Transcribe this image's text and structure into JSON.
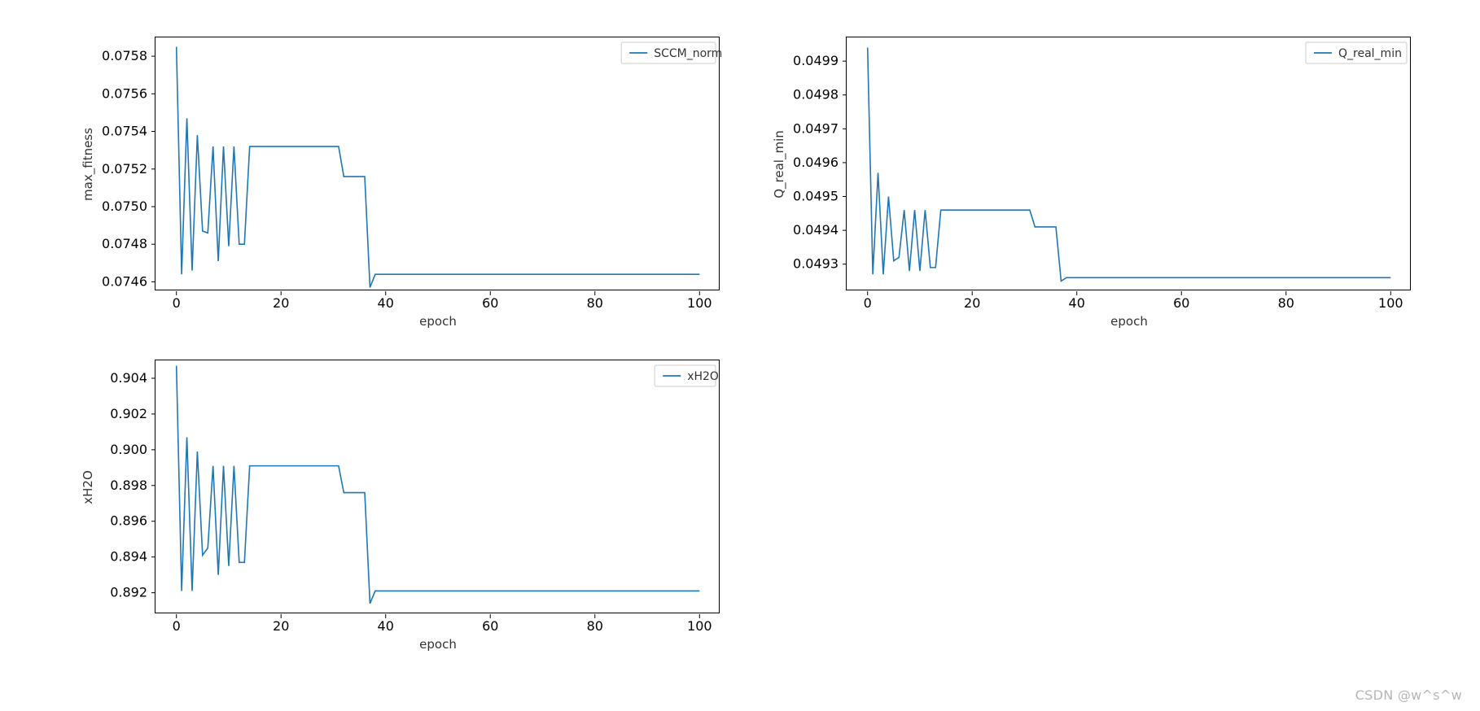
{
  "watermark": "CSDN @w^s^w",
  "chart_data": [
    {
      "type": "line",
      "title": "",
      "legend": "SCCM_norm",
      "legend_position": "upper-right",
      "xlabel": "epoch",
      "ylabel": "max_fitness",
      "xlim": [
        -4,
        104
      ],
      "ylim": [
        0.07455,
        0.0759
      ],
      "xticks": [
        0,
        20,
        40,
        60,
        80,
        100
      ],
      "yticks": [
        0.0746,
        0.0748,
        0.075,
        0.0752,
        0.0754,
        0.0756,
        0.0758
      ],
      "ytick_labels": [
        "0.0746",
        "0.0748",
        "0.0750",
        "0.0752",
        "0.0754",
        "0.0756",
        "0.0758"
      ],
      "x": [
        0,
        1,
        2,
        3,
        4,
        5,
        6,
        7,
        8,
        9,
        10,
        11,
        12,
        13,
        14,
        15,
        16,
        17,
        18,
        19,
        20,
        25,
        30,
        31,
        32,
        33,
        34,
        35,
        36,
        37,
        38,
        39,
        40,
        50,
        60,
        70,
        80,
        90,
        100
      ],
      "y": [
        0.07585,
        0.07464,
        0.07547,
        0.07466,
        0.07538,
        0.07487,
        0.07486,
        0.07532,
        0.07471,
        0.07532,
        0.07479,
        0.07532,
        0.0748,
        0.0748,
        0.07532,
        0.07532,
        0.07532,
        0.07532,
        0.07532,
        0.07532,
        0.07532,
        0.07532,
        0.07532,
        0.07532,
        0.07516,
        0.07516,
        0.07516,
        0.07516,
        0.07516,
        0.07457,
        0.07464,
        0.07464,
        0.07464,
        0.07464,
        0.07464,
        0.07464,
        0.07464,
        0.07464,
        0.07464
      ],
      "series_color": "#1f77b4"
    },
    {
      "type": "line",
      "title": "",
      "legend": "Q_real_min",
      "legend_position": "upper-right",
      "xlabel": "epoch",
      "ylabel": "Q_real_min",
      "xlim": [
        -4,
        104
      ],
      "ylim": [
        0.04922,
        0.04997
      ],
      "xticks": [
        0,
        20,
        40,
        60,
        80,
        100
      ],
      "yticks": [
        0.0493,
        0.0494,
        0.0495,
        0.0496,
        0.0497,
        0.0498,
        0.0499
      ],
      "ytick_labels": [
        "0.0493",
        "0.0494",
        "0.0495",
        "0.0496",
        "0.0497",
        "0.0498",
        "0.0499"
      ],
      "x": [
        0,
        1,
        2,
        3,
        4,
        5,
        6,
        7,
        8,
        9,
        10,
        11,
        12,
        13,
        14,
        15,
        16,
        17,
        18,
        19,
        20,
        25,
        30,
        31,
        32,
        33,
        34,
        35,
        36,
        37,
        38,
        39,
        40,
        50,
        60,
        70,
        80,
        90,
        100
      ],
      "y": [
        0.04994,
        0.04927,
        0.04957,
        0.04927,
        0.0495,
        0.04931,
        0.04932,
        0.04946,
        0.04928,
        0.04946,
        0.04928,
        0.04946,
        0.04929,
        0.04929,
        0.04946,
        0.04946,
        0.04946,
        0.04946,
        0.04946,
        0.04946,
        0.04946,
        0.04946,
        0.04946,
        0.04946,
        0.04941,
        0.04941,
        0.04941,
        0.04941,
        0.04941,
        0.04925,
        0.04926,
        0.04926,
        0.04926,
        0.04926,
        0.04926,
        0.04926,
        0.04926,
        0.04926,
        0.04926
      ],
      "series_color": "#1f77b4"
    },
    {
      "type": "line",
      "title": "",
      "legend": "xH2O",
      "legend_position": "upper-right",
      "xlabel": "epoch",
      "ylabel": "xH2O",
      "xlim": [
        -4,
        104
      ],
      "ylim": [
        0.8908,
        0.905
      ],
      "xticks": [
        0,
        20,
        40,
        60,
        80,
        100
      ],
      "yticks": [
        0.892,
        0.894,
        0.896,
        0.898,
        0.9,
        0.902,
        0.904
      ],
      "ytick_labels": [
        "0.892",
        "0.894",
        "0.896",
        "0.898",
        "0.900",
        "0.902",
        "0.904"
      ],
      "x": [
        0,
        1,
        2,
        3,
        4,
        5,
        6,
        7,
        8,
        9,
        10,
        11,
        12,
        13,
        14,
        15,
        16,
        17,
        18,
        19,
        20,
        25,
        30,
        31,
        32,
        33,
        34,
        35,
        36,
        37,
        38,
        39,
        40,
        50,
        60,
        70,
        80,
        90,
        100
      ],
      "y": [
        0.9047,
        0.8921,
        0.9007,
        0.8921,
        0.8999,
        0.8941,
        0.8945,
        0.8991,
        0.893,
        0.8991,
        0.8935,
        0.8991,
        0.8937,
        0.8937,
        0.8991,
        0.8991,
        0.8991,
        0.8991,
        0.8991,
        0.8991,
        0.8991,
        0.8991,
        0.8991,
        0.8991,
        0.8976,
        0.8976,
        0.8976,
        0.8976,
        0.8976,
        0.8914,
        0.8921,
        0.8921,
        0.8921,
        0.8921,
        0.8921,
        0.8921,
        0.8921,
        0.8921,
        0.8921
      ],
      "series_color": "#1f77b4"
    }
  ],
  "layout": {
    "axes_left_margin": 110,
    "axes_bottom_margin": 50,
    "axes_top_margin": 5,
    "axes_right_margin": 5
  }
}
